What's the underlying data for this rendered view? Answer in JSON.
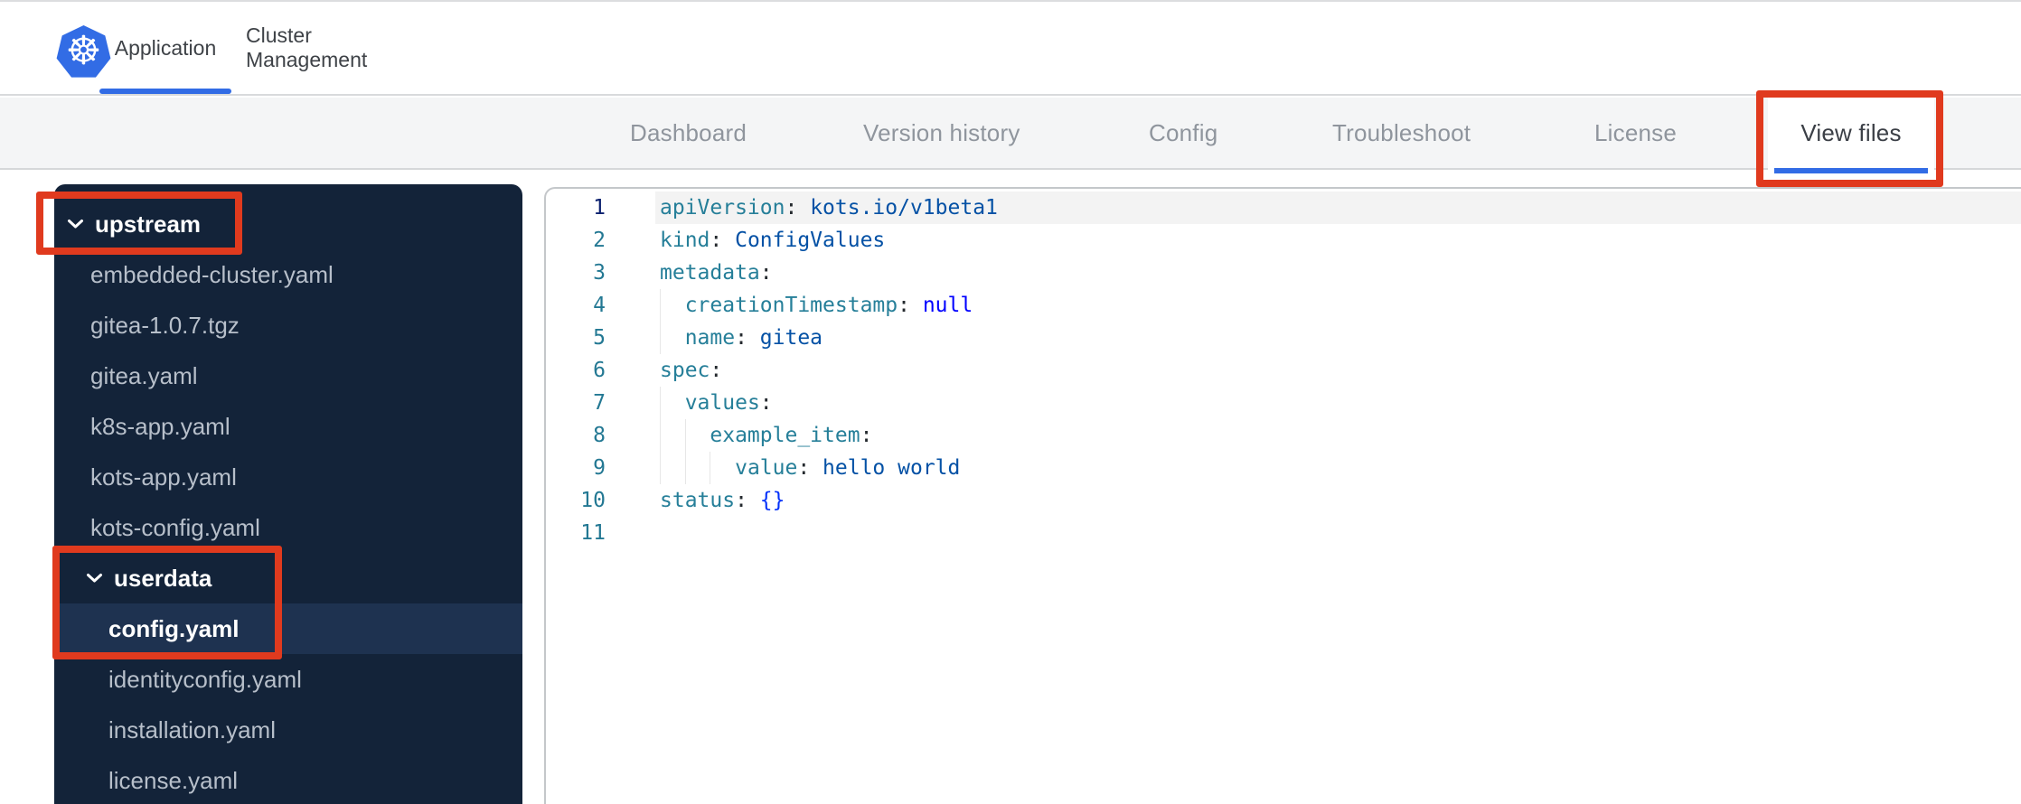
{
  "colors": {
    "accent_blue": "#326ce5",
    "annotation_red": "#e03a1e",
    "sidebar_bg": "#132339",
    "sidebar_selected_bg": "#1e3250",
    "subnav_bg": "#f4f5f6",
    "yaml_key": "#267f99",
    "yaml_value": "#0451a5",
    "yaml_keyword": "#0000ff",
    "yaml_bracket": "#0431fa",
    "line_number": "#237893",
    "line_number_active": "#0b216f"
  },
  "topbar": {
    "logo_icon": "kubernetes-helm-icon",
    "logo_glyph": "☸",
    "tabs": [
      {
        "label": "Application",
        "active": true
      },
      {
        "label": "Cluster Management",
        "active": false
      }
    ]
  },
  "subnav": {
    "tabs": [
      {
        "label": "Dashboard",
        "active": false
      },
      {
        "label": "Version history",
        "active": false
      },
      {
        "label": "Config",
        "active": false
      },
      {
        "label": "Troubleshoot",
        "active": false
      },
      {
        "label": "License",
        "active": false
      },
      {
        "label": "View files",
        "active": true
      }
    ]
  },
  "file_tree": [
    {
      "type": "folder",
      "label": "upstream",
      "level": 0,
      "expanded": true,
      "annotated": true
    },
    {
      "type": "file",
      "label": "embedded-cluster.yaml",
      "level": 1
    },
    {
      "type": "file",
      "label": "gitea-1.0.7.tgz",
      "level": 1
    },
    {
      "type": "file",
      "label": "gitea.yaml",
      "level": 1
    },
    {
      "type": "file",
      "label": "k8s-app.yaml",
      "level": 1
    },
    {
      "type": "file",
      "label": "kots-app.yaml",
      "level": 1
    },
    {
      "type": "file",
      "label": "kots-config.yaml",
      "level": 1
    },
    {
      "type": "folder",
      "label": "userdata",
      "level": 1,
      "expanded": true,
      "annotated": true
    },
    {
      "type": "file",
      "label": "config.yaml",
      "level": 2,
      "selected": true,
      "annotated": true
    },
    {
      "type": "file",
      "label": "identityconfig.yaml",
      "level": 2
    },
    {
      "type": "file",
      "label": "installation.yaml",
      "level": 2
    },
    {
      "type": "file",
      "label": "license.yaml",
      "level": 2
    }
  ],
  "editor": {
    "language": "yaml",
    "lines": [
      {
        "number": 1,
        "active": true,
        "indent": 0,
        "tokens": [
          {
            "type": "key",
            "text": "apiVersion"
          },
          {
            "type": "pn",
            "text": ": "
          },
          {
            "type": "val",
            "text": "kots.io/v1beta1"
          }
        ]
      },
      {
        "number": 2,
        "indent": 0,
        "tokens": [
          {
            "type": "key",
            "text": "kind"
          },
          {
            "type": "pn",
            "text": ": "
          },
          {
            "type": "val",
            "text": "ConfigValues"
          }
        ]
      },
      {
        "number": 3,
        "indent": 0,
        "tokens": [
          {
            "type": "key",
            "text": "metadata"
          },
          {
            "type": "pn",
            "text": ":"
          }
        ]
      },
      {
        "number": 4,
        "indent": 2,
        "tokens": [
          {
            "type": "key",
            "text": "creationTimestamp"
          },
          {
            "type": "pn",
            "text": ": "
          },
          {
            "type": "kw",
            "text": "null"
          }
        ]
      },
      {
        "number": 5,
        "indent": 2,
        "tokens": [
          {
            "type": "key",
            "text": "name"
          },
          {
            "type": "pn",
            "text": ": "
          },
          {
            "type": "val",
            "text": "gitea"
          }
        ]
      },
      {
        "number": 6,
        "indent": 0,
        "tokens": [
          {
            "type": "key",
            "text": "spec"
          },
          {
            "type": "pn",
            "text": ":"
          }
        ]
      },
      {
        "number": 7,
        "indent": 2,
        "tokens": [
          {
            "type": "key",
            "text": "values"
          },
          {
            "type": "pn",
            "text": ":"
          }
        ]
      },
      {
        "number": 8,
        "indent": 4,
        "tokens": [
          {
            "type": "key",
            "text": "example_item"
          },
          {
            "type": "pn",
            "text": ":"
          }
        ]
      },
      {
        "number": 9,
        "indent": 6,
        "tokens": [
          {
            "type": "key",
            "text": "value"
          },
          {
            "type": "pn",
            "text": ": "
          },
          {
            "type": "val",
            "text": "hello world"
          }
        ]
      },
      {
        "number": 10,
        "indent": 0,
        "tokens": [
          {
            "type": "key",
            "text": "status"
          },
          {
            "type": "pn",
            "text": ": "
          },
          {
            "type": "br",
            "text": "{}"
          }
        ]
      },
      {
        "number": 11,
        "indent": 0,
        "tokens": []
      }
    ]
  },
  "annotations": [
    {
      "target": "upstream-folder"
    },
    {
      "target": "userdata-config-yaml"
    },
    {
      "target": "view-files-tab"
    }
  ]
}
